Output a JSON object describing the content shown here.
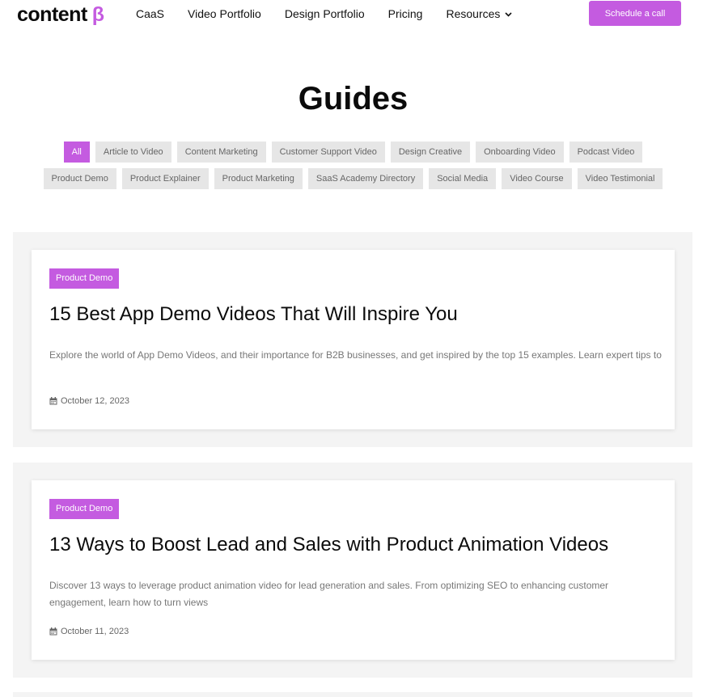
{
  "brand": {
    "name": "content",
    "mark": "β"
  },
  "nav": [
    {
      "label": "CaaS"
    },
    {
      "label": "Video Portfolio"
    },
    {
      "label": "Design Portfolio"
    },
    {
      "label": "Pricing"
    },
    {
      "label": "Resources"
    }
  ],
  "cta_label": "Schedule a call",
  "page_title": "Guides",
  "filters": [
    "All",
    "Article to Video",
    "Content Marketing",
    "Customer Support Video",
    "Design Creative",
    "Onboarding Video",
    "Podcast Video",
    "Product Demo",
    "Product Explainer",
    "Product Marketing",
    "SaaS Academy Directory",
    "Social Media",
    "Video Course",
    "Video Testimonial"
  ],
  "active_filter": "All",
  "posts": [
    {
      "tag": "Product Demo",
      "title": "15 Best App Demo Videos That Will Inspire You",
      "excerpt": "Explore the world of App Demo Videos, and their importance for B2B businesses, and get inspired by the top 15 examples. Learn expert tips to",
      "date": "October 12, 2023"
    },
    {
      "tag": "Product Demo",
      "title": "13 Ways to Boost Lead and Sales with Product Animation Videos",
      "excerpt": "Discover 13 ways to leverage product animation video for lead generation and sales. From optimizing SEO to enhancing customer engagement, learn how to turn views",
      "date": "October 11, 2023"
    }
  ],
  "colors": {
    "accent": "#c45be0",
    "chip_bg": "#e6e6e6",
    "section_bg": "#f4f4f4"
  },
  "icons": {
    "date": "calendar-icon",
    "dropdown": "chevron-down-icon"
  }
}
